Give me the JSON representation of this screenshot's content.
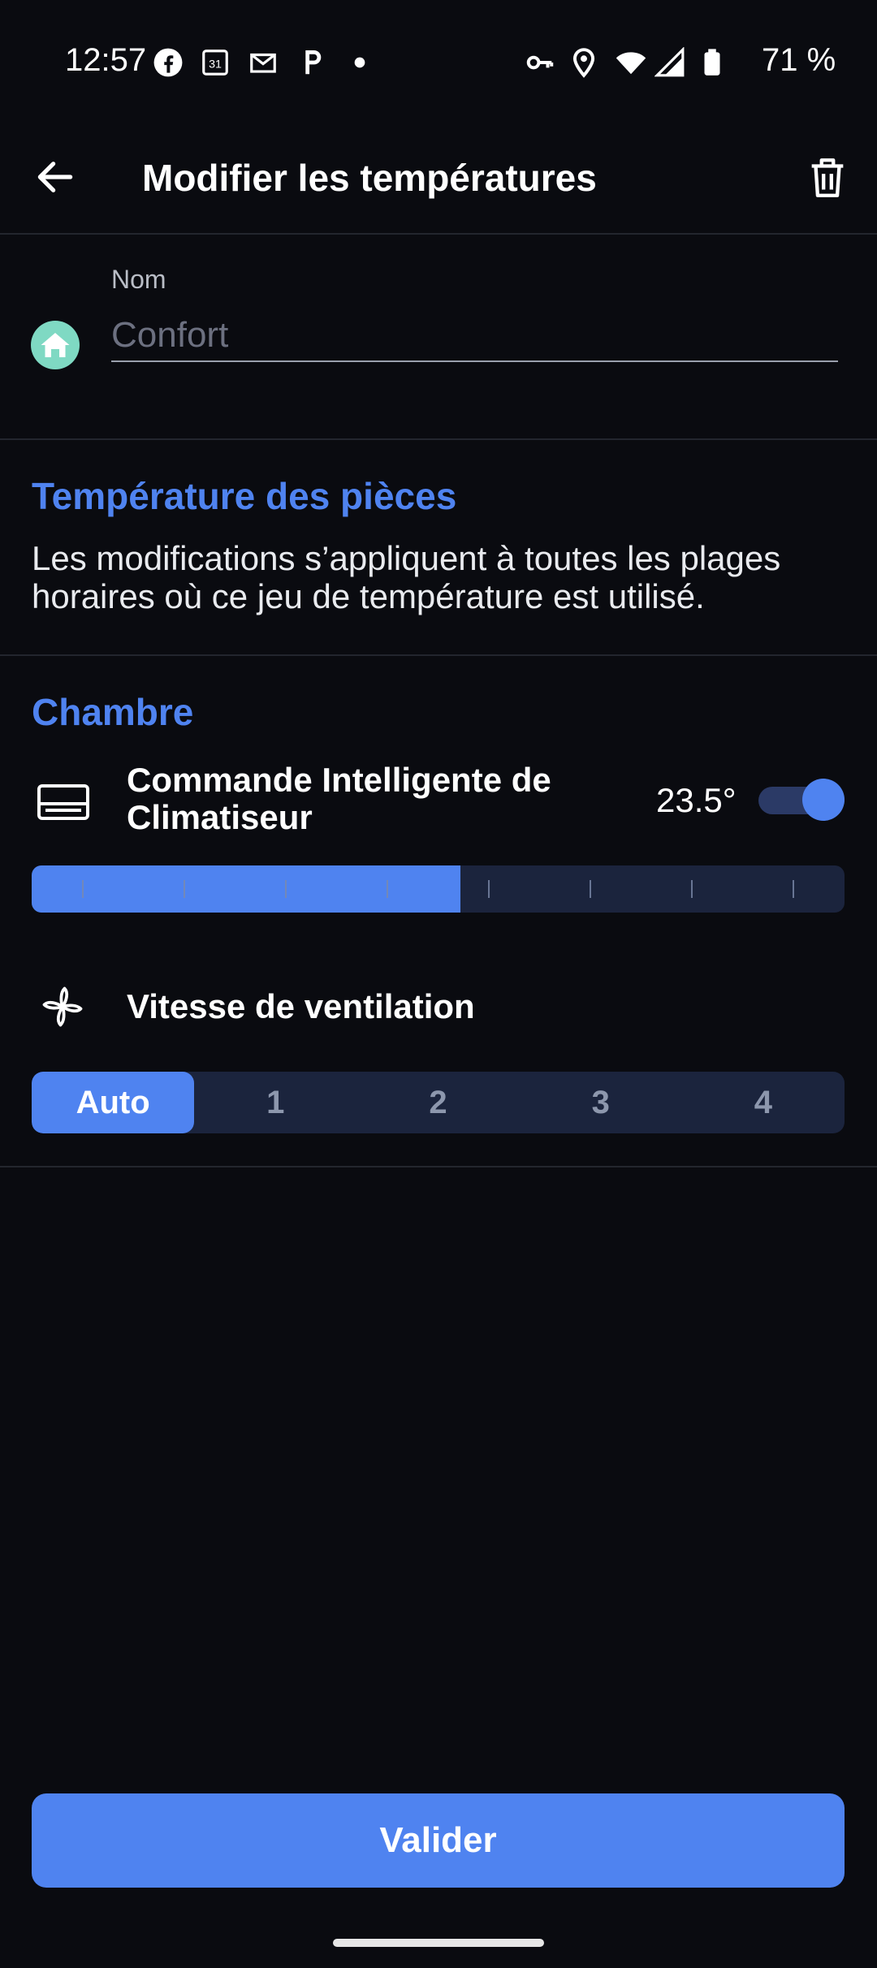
{
  "status_bar": {
    "time": "12:57",
    "battery": "71 %",
    "left_icons": [
      "facebook-icon",
      "calendar-icon",
      "gmail-icon",
      "p-app-icon",
      "dot-icon"
    ],
    "right_icons": [
      "key-icon",
      "location-icon",
      "wifi-icon",
      "signal-icon",
      "battery-icon"
    ]
  },
  "header": {
    "title": "Modifier les températures"
  },
  "name_field": {
    "label": "Nom",
    "placeholder": "Confort",
    "value": ""
  },
  "rooms_section": {
    "title": "Température des pièces",
    "description": "Les modifications s’appliquent à toutes les plages horaires où ce jeu de température est utilisé."
  },
  "room": {
    "name": "Chambre",
    "device": {
      "name": "Commande Intelligente de Climatiseur",
      "temperature": "23.5°",
      "enabled": true,
      "slider_level": 0.527
    },
    "fan": {
      "label": "Vitesse de ventilation",
      "options": [
        "Auto",
        "1",
        "2",
        "3",
        "4"
      ],
      "selected": "Auto"
    }
  },
  "footer": {
    "validate_label": "Valider"
  },
  "colors": {
    "background": "#0a0b10",
    "accent": "#4f83f0",
    "home_badge": "#7fd9c3",
    "slider_track": "#1b243d"
  }
}
